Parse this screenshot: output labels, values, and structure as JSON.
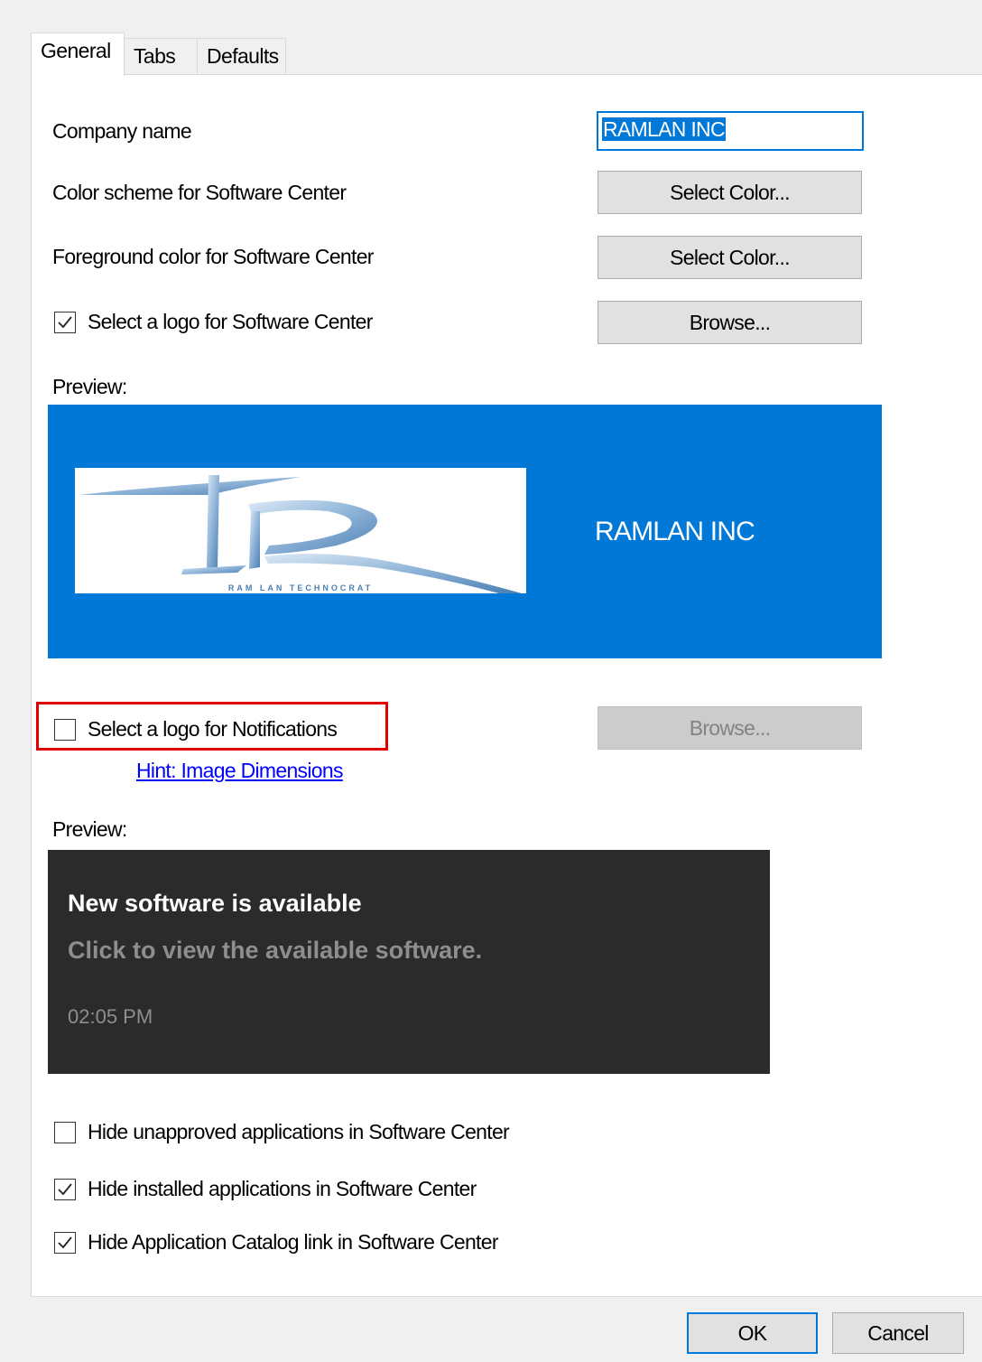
{
  "tabs": [
    "General",
    "Tabs",
    "Defaults"
  ],
  "company": {
    "label": "Company name",
    "value": "RAMLAN INC"
  },
  "color_scheme": {
    "label": "Color scheme for Software Center",
    "button": "Select Color..."
  },
  "foreground": {
    "label": "Foreground color for Software Center",
    "button": "Select Color..."
  },
  "logo_sc": {
    "label": "Select a logo for Software Center",
    "checked": true,
    "button": "Browse..."
  },
  "preview1": {
    "label": "Preview:",
    "company_text": "RAMLAN INC",
    "logo_caption": "RAM LAN TECHNOCRAT",
    "bg_color": "#0078d7"
  },
  "logo_notif": {
    "label": "Select a logo for Notifications",
    "checked": false,
    "button": "Browse...",
    "hint": "Hint: Image Dimensions"
  },
  "preview2": {
    "label": "Preview:",
    "title": "New software is available",
    "message": "Click to view the available software.",
    "time": "02:05 PM"
  },
  "options": [
    {
      "label": "Hide unapproved applications in Software Center",
      "checked": false
    },
    {
      "label": "Hide installed applications in Software Center",
      "checked": true
    },
    {
      "label": "Hide Application Catalog link in Software Center",
      "checked": true
    }
  ],
  "footer": {
    "ok": "OK",
    "cancel": "Cancel"
  }
}
